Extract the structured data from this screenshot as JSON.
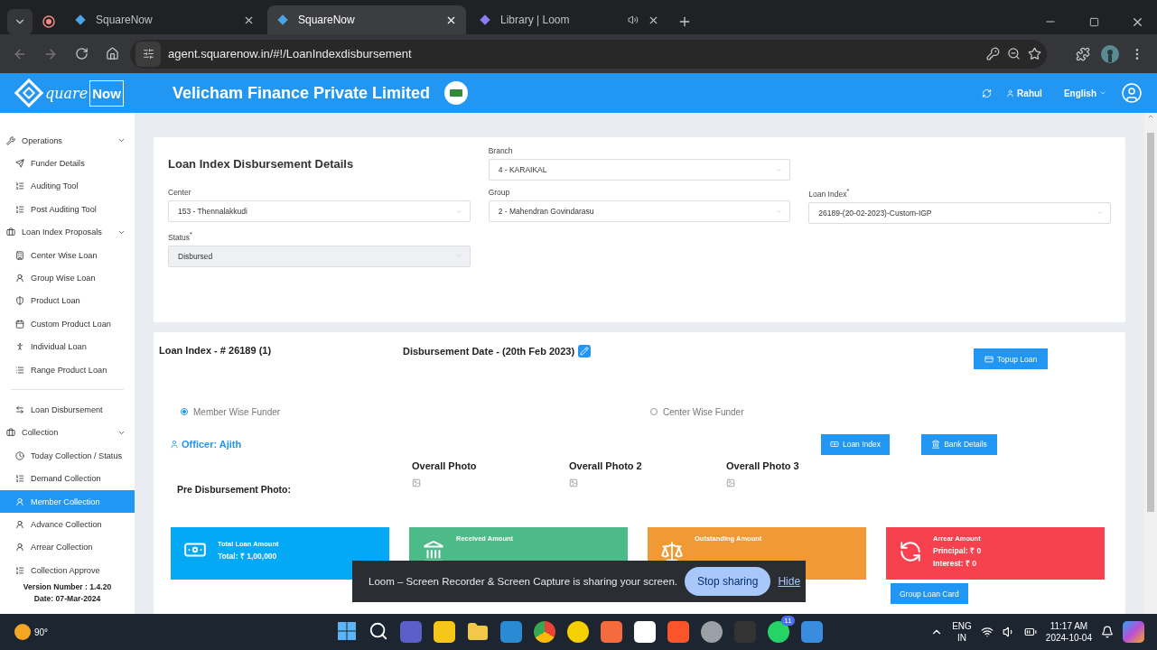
{
  "browser": {
    "tabs": [
      {
        "title": "SquareNow",
        "selected": false
      },
      {
        "title": "SquareNow",
        "selected": true
      },
      {
        "title": "Library | Loom",
        "selected": false
      }
    ],
    "url": "agent.squarenow.in/#!/LoanIndexdisbursement"
  },
  "header": {
    "logo_script": "quare",
    "logo_box": "Now",
    "company": "Velicham Finance Private Limited",
    "user": "Rahul",
    "language": "English"
  },
  "sidebar": {
    "entries": [
      {
        "kind": "group",
        "label": "Operations",
        "expanded": true,
        "children": [
          {
            "label": "Funder Details",
            "selected": false
          },
          {
            "label": "Auditing Tool",
            "selected": false
          },
          {
            "label": "Post Auditing Tool",
            "selected": false
          }
        ]
      },
      {
        "kind": "group",
        "label": "Loan Index Proposals",
        "expanded": true,
        "children": [
          {
            "label": "Center Wise Loan",
            "selected": false
          },
          {
            "label": "Group Wise Loan",
            "selected": false
          },
          {
            "label": "Product Loan",
            "selected": false
          },
          {
            "label": "Custom Product Loan",
            "selected": false
          },
          {
            "label": "Individual Loan",
            "selected": false
          },
          {
            "label": "Range Product Loan",
            "selected": false
          }
        ]
      },
      {
        "kind": "divider"
      },
      {
        "kind": "item",
        "label": "Loan Disbursement",
        "selected": false
      },
      {
        "kind": "group",
        "label": "Collection",
        "expanded": true,
        "children": [
          {
            "label": "Today Collection / Status",
            "selected": false
          },
          {
            "label": "Demand Collection",
            "selected": false
          },
          {
            "label": "Member Collection",
            "selected": true
          },
          {
            "label": "Advance Collection",
            "selected": false
          },
          {
            "label": "Arrear Collection",
            "selected": false
          },
          {
            "label": "Collection Approve",
            "selected": false
          }
        ]
      }
    ],
    "version": "Version Number : 1.4.20",
    "date": "Date: 07-Mar-2024"
  },
  "details": {
    "title": "Loan Index Disbursement Details",
    "fields": [
      {
        "label": "Branch",
        "value": "4 - KARAIKAL",
        "disabled": false
      },
      {
        "label": "Center",
        "value": "153 - Thennalakkudi",
        "disabled": false
      },
      {
        "label": "Group",
        "value": "2 - Mahendran Govindarasu",
        "disabled": false
      },
      {
        "label": "Loan Index",
        "value": "26189-(20-02-2023)-Custom-IGP",
        "required_mark": "*",
        "disabled": false
      },
      {
        "label": "Status",
        "value": "Disbursed",
        "required_mark": "*",
        "disabled": true
      }
    ]
  },
  "loan": {
    "index": "Loan Index - # 26189 (1)",
    "disbursement_date": "Disbursement Date - (20th Feb 2023)",
    "topup_button": "Topup Loan",
    "funders": [
      {
        "label": "Member Wise Funder",
        "selected": true
      },
      {
        "label": "Center Wise Funder",
        "selected": false
      }
    ],
    "officer": "Officer: Ajith",
    "loan_index_button": "Loan Index",
    "bank_details_button": "Bank Details",
    "photo_label": "Pre Disbursement Photo:",
    "photos": [
      "Overall Photo",
      "Overall Photo 2",
      "Overall Photo 3"
    ],
    "cards": [
      {
        "title": "Total Loan Amount",
        "lines": [
          "Total: ₹ 1,00,000"
        ],
        "color": "#03a9f4"
      },
      {
        "title": "Received Amount",
        "color": "#4cbb87"
      },
      {
        "title": "Outstanding Amount",
        "color": "#f19a35"
      },
      {
        "title": "Arrear Amount",
        "lines": [
          "Principal: ₹ 0",
          "Interest: ₹ 0"
        ],
        "color": "#f7414f"
      }
    ],
    "group_card_button": "Group Loan Card"
  },
  "share_bar": {
    "text": "Loom – Screen Recorder & Screen Capture is sharing your screen.",
    "stop": "Stop sharing",
    "hide": "Hide"
  },
  "taskbar": {
    "weather": "90°",
    "whatsapp_badge": "11",
    "language": "ENG",
    "region": "IN",
    "time": "11:17 AM",
    "date": "2024-10-04"
  }
}
